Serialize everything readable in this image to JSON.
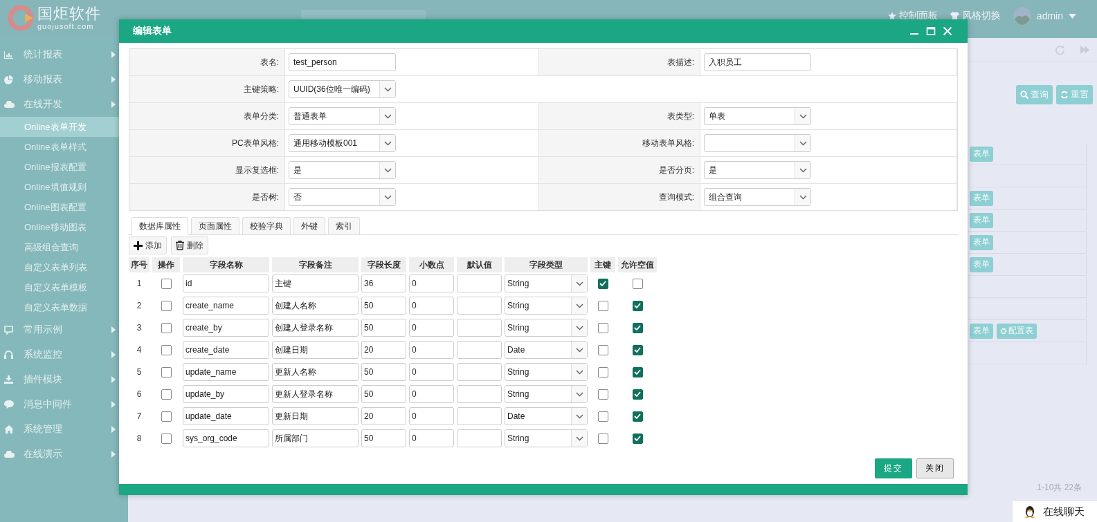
{
  "header": {
    "logo_title": "国炬软件",
    "logo_subtitle": "guojusoft.com",
    "menu": [
      {
        "label": "控制面板",
        "kind": "star"
      },
      {
        "label": "风格切换",
        "kind": "shirt"
      }
    ],
    "user": "admin"
  },
  "sidebar": {
    "items": [
      {
        "label": "统计报表",
        "kind": "bar-chart"
      },
      {
        "label": "移动报表",
        "kind": "pie"
      },
      {
        "label": "在线开发",
        "kind": "cloud",
        "children": [
          {
            "label": "Online表单开发",
            "selected": true
          },
          {
            "label": "Online表单样式",
            "selected": false
          },
          {
            "label": "Online报表配置",
            "selected": false
          },
          {
            "label": "Online填值规则",
            "selected": false
          },
          {
            "label": "Online图表配置",
            "selected": false
          },
          {
            "label": "Online移动图表",
            "selected": false
          },
          {
            "label": "高级组合查询",
            "selected": false
          },
          {
            "label": "自定义表单列表",
            "selected": false
          },
          {
            "label": "自定义表单模板",
            "selected": false
          },
          {
            "label": "自定义表单数据",
            "selected": false
          }
        ]
      },
      {
        "label": "常用示例",
        "kind": "board"
      },
      {
        "label": "系统监控",
        "kind": "headset"
      },
      {
        "label": "插件模块",
        "kind": "download"
      },
      {
        "label": "消息中间件",
        "kind": "chat"
      },
      {
        "label": "系统管理",
        "kind": "home"
      },
      {
        "label": "在线演示",
        "kind": "cloud"
      }
    ]
  },
  "background": {
    "search_buttons": [
      {
        "label": "查询",
        "kind": "search"
      },
      {
        "label": "重置",
        "kind": "refresh"
      }
    ],
    "rows": [
      {
        "actions": [
          {
            "label": "表单",
            "kind": "plain"
          }
        ]
      },
      {},
      {
        "actions": [
          {
            "label": "表单",
            "kind": "plain"
          }
        ]
      },
      {
        "actions": [
          {
            "label": "表单",
            "kind": "plain"
          }
        ]
      },
      {
        "actions": [
          {
            "label": "表单",
            "kind": "plain"
          }
        ]
      },
      {
        "actions": [
          {
            "label": "表单",
            "kind": "plain"
          }
        ]
      },
      {},
      {},
      {
        "actions": [
          {
            "label": "表单",
            "kind": "plain"
          },
          {
            "label": "配置表",
            "kind": "gear"
          }
        ]
      },
      {}
    ],
    "pagination": "1-10共 22条",
    "chat": "在线聊天"
  },
  "dialog": {
    "title": "编辑表单",
    "form_rows": [
      {
        "fields": [
          {
            "label": "表名:",
            "kind": "input",
            "value": "test_person"
          },
          {
            "label": "表描述:",
            "kind": "input",
            "value": "入职员工"
          }
        ]
      },
      {
        "fields": [
          {
            "label": "主键策略:",
            "kind": "select",
            "value": "UUID(36位唯一编码)"
          }
        ]
      },
      {
        "fields": [
          {
            "label": "表单分类:",
            "kind": "select",
            "value": "普通表单"
          },
          {
            "label": "表类型:",
            "kind": "select",
            "value": "单表"
          }
        ]
      },
      {
        "fields": [
          {
            "label": "PC表单风格:",
            "kind": "select",
            "value": "通用移动模板001"
          },
          {
            "label": "移动表单风格:",
            "kind": "select"
          }
        ]
      },
      {
        "fields": [
          {
            "label": "显示复选框:",
            "kind": "select",
            "value": "是"
          },
          {
            "label": "是否分页:",
            "kind": "select",
            "value": "是"
          }
        ]
      },
      {
        "fields": [
          {
            "label": "是否树:",
            "kind": "select",
            "value": "否"
          },
          {
            "label": "查询模式:",
            "kind": "select",
            "value": "组合查询"
          }
        ]
      }
    ],
    "tabs": [
      {
        "label": "数据库属性",
        "selected": true
      },
      {
        "label": "页面属性",
        "selected": false
      },
      {
        "label": "校验字典",
        "selected": false
      },
      {
        "label": "外键",
        "selected": false
      },
      {
        "label": "索引",
        "selected": false
      }
    ],
    "toolbar": [
      {
        "label": "添加",
        "kind": "add"
      },
      {
        "label": "删除",
        "kind": "delete"
      }
    ],
    "columns": [
      "序号",
      "操作",
      "字段名称",
      "字段备注",
      "字段长度",
      "小数点",
      "默认值",
      "字段类型",
      "主键",
      "允许空值"
    ],
    "rows": [
      {
        "no": "1",
        "checked": false,
        "name": "id",
        "comment": "主键",
        "length": "36",
        "decimals": "0",
        "type": "String",
        "primary_key": true,
        "nullable": false
      },
      {
        "no": "2",
        "checked": false,
        "name": "create_name",
        "comment": "创建人名称",
        "length": "50",
        "decimals": "0",
        "type": "String",
        "primary_key": false,
        "nullable": true
      },
      {
        "no": "3",
        "checked": false,
        "name": "create_by",
        "comment": "创建人登录名称",
        "length": "50",
        "decimals": "0",
        "type": "String",
        "primary_key": false,
        "nullable": true
      },
      {
        "no": "4",
        "checked": false,
        "name": "create_date",
        "comment": "创建日期",
        "length": "20",
        "decimals": "0",
        "type": "Date",
        "primary_key": false,
        "nullable": true
      },
      {
        "no": "5",
        "checked": false,
        "name": "update_name",
        "comment": "更新人名称",
        "length": "50",
        "decimals": "0",
        "type": "String",
        "primary_key": false,
        "nullable": true
      },
      {
        "no": "6",
        "checked": false,
        "name": "update_by",
        "comment": "更新人登录名称",
        "length": "50",
        "decimals": "0",
        "type": "String",
        "primary_key": false,
        "nullable": true
      },
      {
        "no": "7",
        "checked": false,
        "name": "update_date",
        "comment": "更新日期",
        "length": "20",
        "decimals": "0",
        "type": "Date",
        "primary_key": false,
        "nullable": true
      },
      {
        "no": "8",
        "checked": false,
        "name": "sys_org_code",
        "comment": "所属部门",
        "length": "50",
        "decimals": "0",
        "type": "String",
        "primary_key": false,
        "nullable": true
      }
    ],
    "buttons": [
      {
        "label": "提交",
        "kind": "primary"
      },
      {
        "label": "关闭",
        "kind": "default"
      }
    ]
  }
}
